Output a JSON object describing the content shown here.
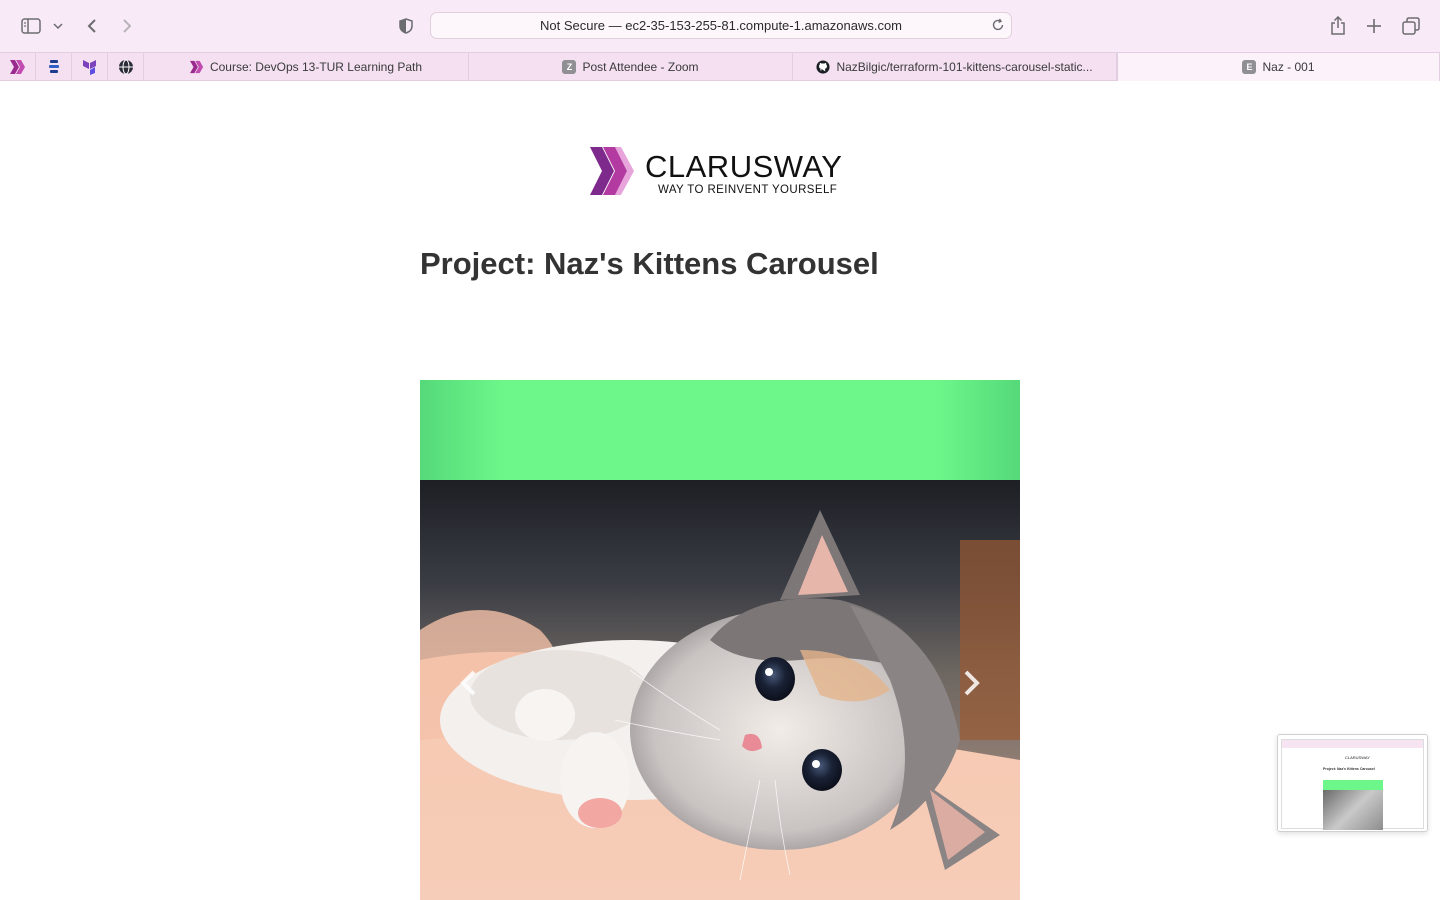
{
  "browser": {
    "address": "Not Secure — ec2-35-153-255-81.compute-1.amazonaws.com",
    "tabs": [
      {
        "title": "Course: DevOps 13-TUR Learning Path",
        "favicon": "clarusway-icon"
      },
      {
        "title": "Post Attendee - Zoom",
        "favicon": "Z"
      },
      {
        "title": "NazBilgic/terraform-101-kittens-carousel-static...",
        "favicon": "github-icon"
      },
      {
        "title": "Naz - 001",
        "favicon": "E"
      }
    ],
    "pinned_tabs": [
      "clarusway-icon",
      "stack-icon",
      "terraform-icon",
      "globe-icon"
    ]
  },
  "page": {
    "logo_name": "CLARUSWAY",
    "logo_tagline": "WAY TO REINVENT YOURSELF",
    "title": "Project: Naz's Kittens Carousel"
  },
  "colors": {
    "toolbar_bg": "#f9eaf7",
    "carousel_band": "#6df78a",
    "brand_purple": "#9b2a8f"
  }
}
